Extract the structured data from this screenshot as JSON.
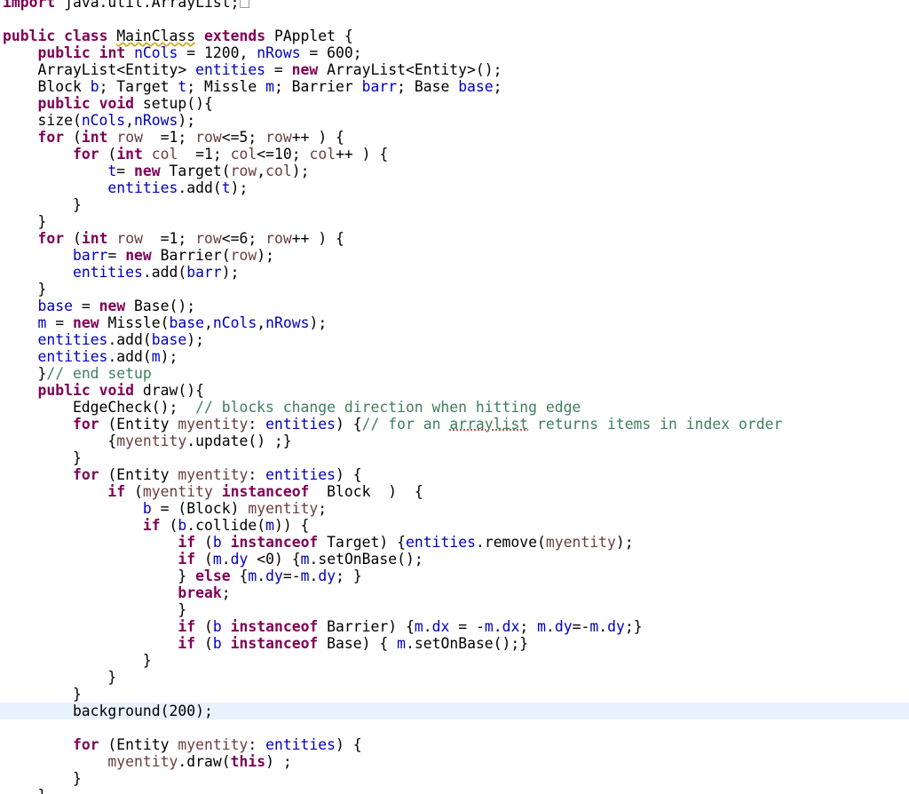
{
  "colors": {
    "keyword": "#7f0055",
    "field": "#0000c0",
    "local_variable": "#6a3e3e",
    "comment": "#3f7f5f",
    "current_line_highlight": "#e8f2fe"
  },
  "icons": {
    "folded_imports": "collapsed-block-icon"
  },
  "editor": {
    "current_line": 42,
    "lines": [
      [
        [
          "kw",
          "import"
        ],
        [
          "p",
          " java.util.ArrayList;"
        ]
      ],
      [],
      [
        [
          "kw",
          "public"
        ],
        [
          "p",
          " "
        ],
        [
          "kw",
          "class"
        ],
        [
          "p",
          " "
        ],
        [
          "warn",
          "MainClass"
        ],
        [
          "p",
          " "
        ],
        [
          "kw",
          "extends"
        ],
        [
          "p",
          " PApplet {"
        ]
      ],
      [
        [
          "p",
          "    "
        ],
        [
          "kw",
          "public"
        ],
        [
          "p",
          " "
        ],
        [
          "kw",
          "int"
        ],
        [
          "p",
          " "
        ],
        [
          "fld",
          "nCols"
        ],
        [
          "p",
          " = 1200, "
        ],
        [
          "fld",
          "nRows"
        ],
        [
          "p",
          " = 600;"
        ]
      ],
      [
        [
          "p",
          "    ArrayList<Entity> "
        ],
        [
          "fld",
          "entities"
        ],
        [
          "p",
          " = "
        ],
        [
          "kw",
          "new"
        ],
        [
          "p",
          " ArrayList<Entity>();"
        ]
      ],
      [
        [
          "p",
          "    Block "
        ],
        [
          "fld",
          "b"
        ],
        [
          "p",
          "; Target "
        ],
        [
          "fld",
          "t"
        ],
        [
          "p",
          "; Missle "
        ],
        [
          "fld",
          "m"
        ],
        [
          "p",
          "; Barrier "
        ],
        [
          "fld",
          "barr"
        ],
        [
          "p",
          "; Base "
        ],
        [
          "fld",
          "base"
        ],
        [
          "p",
          ";"
        ]
      ],
      [
        [
          "p",
          "    "
        ],
        [
          "kw",
          "public"
        ],
        [
          "p",
          " "
        ],
        [
          "kw",
          "void"
        ],
        [
          "p",
          " setup(){"
        ]
      ],
      [
        [
          "p",
          "    size("
        ],
        [
          "fld",
          "nCols"
        ],
        [
          "p",
          ","
        ],
        [
          "fld",
          "nRows"
        ],
        [
          "p",
          ");"
        ]
      ],
      [
        [
          "p",
          "    "
        ],
        [
          "kw",
          "for"
        ],
        [
          "p",
          " ("
        ],
        [
          "kw",
          "int"
        ],
        [
          "p",
          " "
        ],
        [
          "var",
          "row"
        ],
        [
          "p",
          "  =1; "
        ],
        [
          "var",
          "row"
        ],
        [
          "p",
          "<=5; "
        ],
        [
          "var",
          "row"
        ],
        [
          "p",
          "++ ) {"
        ]
      ],
      [
        [
          "p",
          "        "
        ],
        [
          "kw",
          "for"
        ],
        [
          "p",
          " ("
        ],
        [
          "kw",
          "int"
        ],
        [
          "p",
          " "
        ],
        [
          "var",
          "col"
        ],
        [
          "p",
          "  =1; "
        ],
        [
          "var",
          "col"
        ],
        [
          "p",
          "<=10; "
        ],
        [
          "var",
          "col"
        ],
        [
          "p",
          "++ ) {"
        ]
      ],
      [
        [
          "p",
          "            "
        ],
        [
          "fld",
          "t"
        ],
        [
          "p",
          "= "
        ],
        [
          "kw",
          "new"
        ],
        [
          "p",
          " Target("
        ],
        [
          "var",
          "row"
        ],
        [
          "p",
          ","
        ],
        [
          "var",
          "col"
        ],
        [
          "p",
          ");"
        ]
      ],
      [
        [
          "p",
          "            "
        ],
        [
          "fld",
          "entities"
        ],
        [
          "p",
          ".add("
        ],
        [
          "fld",
          "t"
        ],
        [
          "p",
          ");"
        ]
      ],
      [
        [
          "p",
          "        }"
        ]
      ],
      [
        [
          "p",
          "    }"
        ]
      ],
      [
        [
          "p",
          "    "
        ],
        [
          "kw",
          "for"
        ],
        [
          "p",
          " ("
        ],
        [
          "kw",
          "int"
        ],
        [
          "p",
          " "
        ],
        [
          "var",
          "row"
        ],
        [
          "p",
          "  =1; "
        ],
        [
          "var",
          "row"
        ],
        [
          "p",
          "<=6; "
        ],
        [
          "var",
          "row"
        ],
        [
          "p",
          "++ ) {"
        ]
      ],
      [
        [
          "p",
          "        "
        ],
        [
          "fld",
          "barr"
        ],
        [
          "p",
          "= "
        ],
        [
          "kw",
          "new"
        ],
        [
          "p",
          " Barrier("
        ],
        [
          "var",
          "row"
        ],
        [
          "p",
          ");"
        ]
      ],
      [
        [
          "p",
          "        "
        ],
        [
          "fld",
          "entities"
        ],
        [
          "p",
          ".add("
        ],
        [
          "fld",
          "barr"
        ],
        [
          "p",
          ");"
        ]
      ],
      [
        [
          "p",
          "    }"
        ]
      ],
      [
        [
          "p",
          "    "
        ],
        [
          "fld",
          "base"
        ],
        [
          "p",
          " = "
        ],
        [
          "kw",
          "new"
        ],
        [
          "p",
          " Base();"
        ]
      ],
      [
        [
          "p",
          "    "
        ],
        [
          "fld",
          "m"
        ],
        [
          "p",
          " = "
        ],
        [
          "kw",
          "new"
        ],
        [
          "p",
          " Missle("
        ],
        [
          "fld",
          "base"
        ],
        [
          "p",
          ","
        ],
        [
          "fld",
          "nCols"
        ],
        [
          "p",
          ","
        ],
        [
          "fld",
          "nRows"
        ],
        [
          "p",
          ");"
        ]
      ],
      [
        [
          "p",
          "    "
        ],
        [
          "fld",
          "entities"
        ],
        [
          "p",
          ".add("
        ],
        [
          "fld",
          "base"
        ],
        [
          "p",
          ");"
        ]
      ],
      [
        [
          "p",
          "    "
        ],
        [
          "fld",
          "entities"
        ],
        [
          "p",
          ".add("
        ],
        [
          "fld",
          "m"
        ],
        [
          "p",
          ");"
        ]
      ],
      [
        [
          "p",
          "    }"
        ],
        [
          "cm",
          "// end setup"
        ]
      ],
      [
        [
          "p",
          "    "
        ],
        [
          "kw",
          "public"
        ],
        [
          "p",
          " "
        ],
        [
          "kw",
          "void"
        ],
        [
          "p",
          " draw(){"
        ]
      ],
      [
        [
          "p",
          "        EdgeCheck();  "
        ],
        [
          "cm",
          "// blocks change direction when hitting edge"
        ]
      ],
      [
        [
          "p",
          "        "
        ],
        [
          "kw",
          "for"
        ],
        [
          "p",
          " (Entity "
        ],
        [
          "var",
          "myentity"
        ],
        [
          "p",
          ": "
        ],
        [
          "fld",
          "entities"
        ],
        [
          "p",
          ") {"
        ],
        [
          "cm",
          "// for an "
        ],
        [
          "cmspell",
          "arraylist"
        ],
        [
          "cm",
          " returns items in index order"
        ]
      ],
      [
        [
          "p",
          "            {"
        ],
        [
          "var",
          "myentity"
        ],
        [
          "p",
          ".update() ;}"
        ]
      ],
      [
        [
          "p",
          "        }"
        ]
      ],
      [
        [
          "p",
          "        "
        ],
        [
          "kw",
          "for"
        ],
        [
          "p",
          " (Entity "
        ],
        [
          "var",
          "myentity"
        ],
        [
          "p",
          ": "
        ],
        [
          "fld",
          "entities"
        ],
        [
          "p",
          ") {"
        ]
      ],
      [
        [
          "p",
          "            "
        ],
        [
          "kw",
          "if"
        ],
        [
          "p",
          " ("
        ],
        [
          "var",
          "myentity"
        ],
        [
          "p",
          " "
        ],
        [
          "kw",
          "instanceof"
        ],
        [
          "p",
          "  Block  )  {"
        ]
      ],
      [
        [
          "p",
          "                "
        ],
        [
          "fld",
          "b"
        ],
        [
          "p",
          " = (Block) "
        ],
        [
          "var",
          "myentity"
        ],
        [
          "p",
          ";"
        ]
      ],
      [
        [
          "p",
          "                "
        ],
        [
          "kw",
          "if"
        ],
        [
          "p",
          " ("
        ],
        [
          "fld",
          "b"
        ],
        [
          "p",
          ".collide("
        ],
        [
          "fld",
          "m"
        ],
        [
          "p",
          ")) {"
        ]
      ],
      [
        [
          "p",
          "                    "
        ],
        [
          "kw",
          "if"
        ],
        [
          "p",
          " ("
        ],
        [
          "fld",
          "b"
        ],
        [
          "p",
          " "
        ],
        [
          "kw",
          "instanceof"
        ],
        [
          "p",
          " Target) {"
        ],
        [
          "fld",
          "entities"
        ],
        [
          "p",
          ".remove("
        ],
        [
          "var",
          "myentity"
        ],
        [
          "p",
          ");"
        ]
      ],
      [
        [
          "p",
          "                    "
        ],
        [
          "kw",
          "if"
        ],
        [
          "p",
          " ("
        ],
        [
          "fld",
          "m"
        ],
        [
          "p",
          "."
        ],
        [
          "fld",
          "dy"
        ],
        [
          "p",
          " <0) {"
        ],
        [
          "fld",
          "m"
        ],
        [
          "p",
          ".setOnBase();"
        ]
      ],
      [
        [
          "p",
          "                    } "
        ],
        [
          "kw",
          "else"
        ],
        [
          "p",
          " {"
        ],
        [
          "fld",
          "m"
        ],
        [
          "p",
          "."
        ],
        [
          "fld",
          "dy"
        ],
        [
          "p",
          "=-"
        ],
        [
          "fld",
          "m"
        ],
        [
          "p",
          "."
        ],
        [
          "fld",
          "dy"
        ],
        [
          "p",
          "; }"
        ]
      ],
      [
        [
          "p",
          "                    "
        ],
        [
          "kw",
          "break"
        ],
        [
          "p",
          ";"
        ]
      ],
      [
        [
          "p",
          "                    }"
        ]
      ],
      [
        [
          "p",
          "                    "
        ],
        [
          "kw",
          "if"
        ],
        [
          "p",
          " ("
        ],
        [
          "fld",
          "b"
        ],
        [
          "p",
          " "
        ],
        [
          "kw",
          "instanceof"
        ],
        [
          "p",
          " Barrier) {"
        ],
        [
          "fld",
          "m"
        ],
        [
          "p",
          "."
        ],
        [
          "fld",
          "dx"
        ],
        [
          "p",
          " = -"
        ],
        [
          "fld",
          "m"
        ],
        [
          "p",
          "."
        ],
        [
          "fld",
          "dx"
        ],
        [
          "p",
          "; "
        ],
        [
          "fld",
          "m"
        ],
        [
          "p",
          "."
        ],
        [
          "fld",
          "dy"
        ],
        [
          "p",
          "=-"
        ],
        [
          "fld",
          "m"
        ],
        [
          "p",
          "."
        ],
        [
          "fld",
          "dy"
        ],
        [
          "p",
          ";}"
        ]
      ],
      [
        [
          "p",
          "                    "
        ],
        [
          "kw",
          "if"
        ],
        [
          "p",
          " ("
        ],
        [
          "fld",
          "b"
        ],
        [
          "p",
          " "
        ],
        [
          "kw",
          "instanceof"
        ],
        [
          "p",
          " Base) { "
        ],
        [
          "fld",
          "m"
        ],
        [
          "p",
          ".setOnBase();}"
        ]
      ],
      [
        [
          "p",
          "                }"
        ]
      ],
      [
        [
          "p",
          "            }"
        ]
      ],
      [
        [
          "p",
          "        }"
        ]
      ],
      [
        [
          "p",
          "        background(200);"
        ]
      ],
      [],
      [
        [
          "p",
          "        "
        ],
        [
          "kw",
          "for"
        ],
        [
          "p",
          " (Entity "
        ],
        [
          "var",
          "myentity"
        ],
        [
          "p",
          ": "
        ],
        [
          "fld",
          "entities"
        ],
        [
          "p",
          ") {"
        ]
      ],
      [
        [
          "p",
          "            "
        ],
        [
          "var",
          "myentity"
        ],
        [
          "p",
          ".draw("
        ],
        [
          "kw",
          "this"
        ],
        [
          "p",
          ") ;"
        ]
      ],
      [
        [
          "p",
          "        }"
        ]
      ],
      [
        [
          "p",
          "    }"
        ]
      ]
    ]
  }
}
